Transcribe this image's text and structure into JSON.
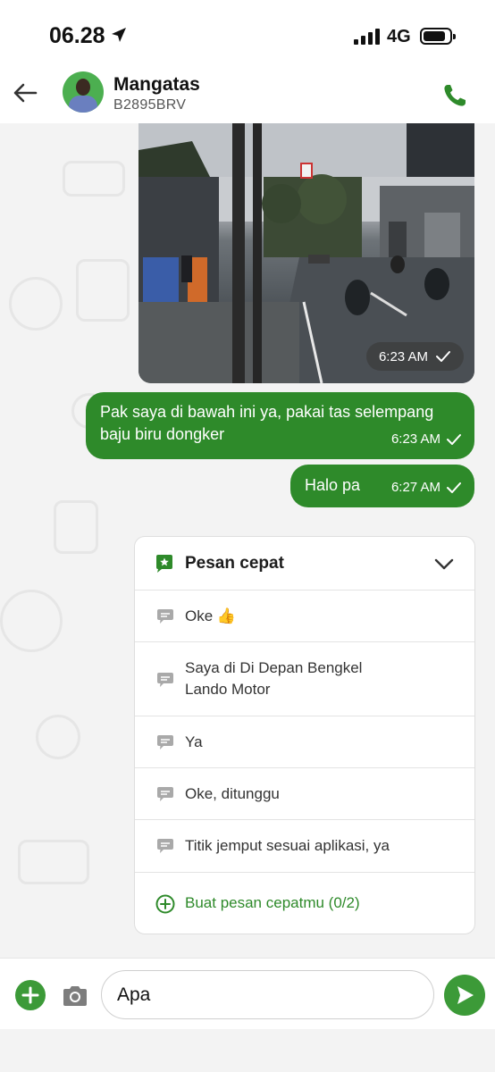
{
  "status_bar": {
    "time": "06.28",
    "network": "4G"
  },
  "header": {
    "contact_name": "Mangatas",
    "plate_number": "B2895BRV"
  },
  "messages": [
    {
      "type": "image",
      "time": "6:23 AM",
      "status": "delivered"
    },
    {
      "type": "text",
      "text_line1": "Pak saya di bawah ini ya, pakai tas selempang",
      "text_line2": "baju biru dongker",
      "time": "6:23 AM",
      "status": "delivered"
    },
    {
      "type": "text",
      "text": "Halo pa",
      "time": "6:27 AM",
      "status": "delivered"
    }
  ],
  "quick_replies": {
    "title": "Pesan cepat",
    "items": [
      {
        "label": "Oke 👍"
      },
      {
        "label_line1": "Saya di Di Depan Bengkel",
        "label_line2": "Lando Motor"
      },
      {
        "label": "Ya"
      },
      {
        "label": "Oke, ditunggu"
      },
      {
        "label": "Titik jemput sesuai aplikasi, ya"
      }
    ],
    "add_label": "Buat pesan cepatmu (0/2)"
  },
  "composer": {
    "value": "Apa"
  },
  "colors": {
    "accent": "#2e8a2a",
    "bubble_bg": "#2e8a2a",
    "header_bg": "#ffffff"
  },
  "icons": {
    "back": "arrow-left-icon",
    "call": "phone-icon",
    "quick_reply": "star-chat-icon",
    "collapse": "chevron-down-icon",
    "reply_item": "chat-bubble-icon",
    "add_quick": "plus-circle-icon",
    "attach": "plus-icon",
    "camera": "camera-icon",
    "send": "send-icon"
  }
}
